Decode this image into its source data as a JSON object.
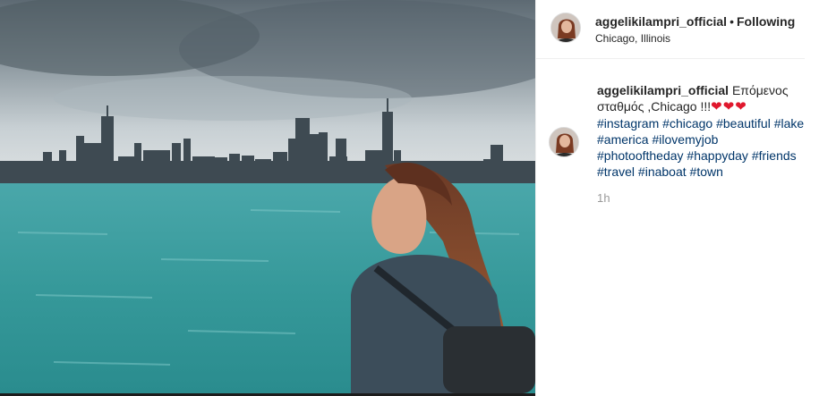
{
  "post": {
    "username": "aggelikilampri_official",
    "separator": "•",
    "follow_status": "Following",
    "location": "Chicago, Illinois",
    "caption": {
      "username": "aggelikilampri_official",
      "text_line1": "Επόμενος",
      "text_line2": "σταθμός ,Chicago !!!",
      "hearts": "❤❤❤",
      "hashtags": [
        "#instagram",
        "#chicago",
        "#beautiful",
        "#lake",
        "#america",
        "#ilovemyjob",
        "#photooftheday",
        "#happyday",
        "#friends",
        "#travel",
        "#inaboat",
        "#town"
      ]
    },
    "timestamp": "1h"
  },
  "colors": {
    "hashtag": "#003569",
    "heart": "#e0182d",
    "muted": "#999999",
    "water": "#3f9da0",
    "sky": "#b9c3c8"
  }
}
